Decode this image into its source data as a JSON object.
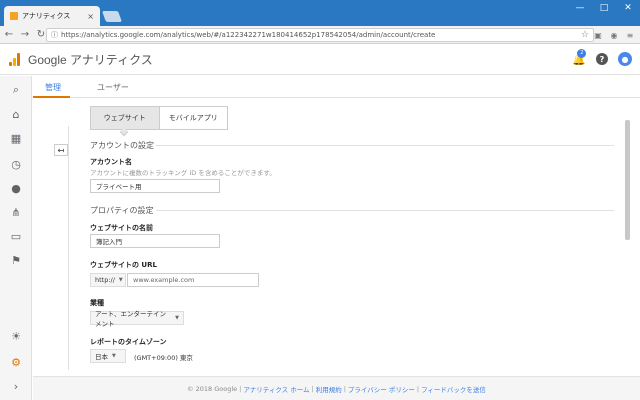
{
  "browser": {
    "tab_title": "アナリティクス",
    "tab_close": "×",
    "url": "https://analytics.google.com/analytics/web/#/a122342271w180414652p178542054/admin/account/create",
    "window_buttons": [
      "—",
      "□",
      "✕"
    ]
  },
  "header": {
    "title": "Google アナリティクス",
    "notification_count": "2"
  },
  "tabs": [
    {
      "label": "管理"
    },
    {
      "label": "ユーザー"
    }
  ],
  "segment": {
    "website": "ウェブサイト",
    "mobile_app": "モバイルアプリ"
  },
  "account_section": {
    "title": "アカウントの設定",
    "name_label": "アカウント名",
    "name_help": "アカウントに複数のトラッキング ID を含めることができます。",
    "name_value": "プライベート用"
  },
  "property_section": {
    "title": "プロパティの設定",
    "site_name_label": "ウェブサイトの名前",
    "site_name_value": "簿記入門",
    "url_label": "ウェブサイトの URL",
    "url_protocol": "http://",
    "url_placeholder": "www.example.com",
    "industry_label": "業種",
    "industry_value": "アート、エンターテインメント",
    "timezone_label": "レポートのタイムゾーン",
    "timezone_country": "日本",
    "timezone_value": "(GMT+09:00) 東京"
  },
  "footer": {
    "copyright": "© 2018 Google",
    "links": [
      "アナリティクス ホーム",
      "利用規約",
      "プライバシー ポリシー",
      "フィードバックを送信"
    ]
  }
}
